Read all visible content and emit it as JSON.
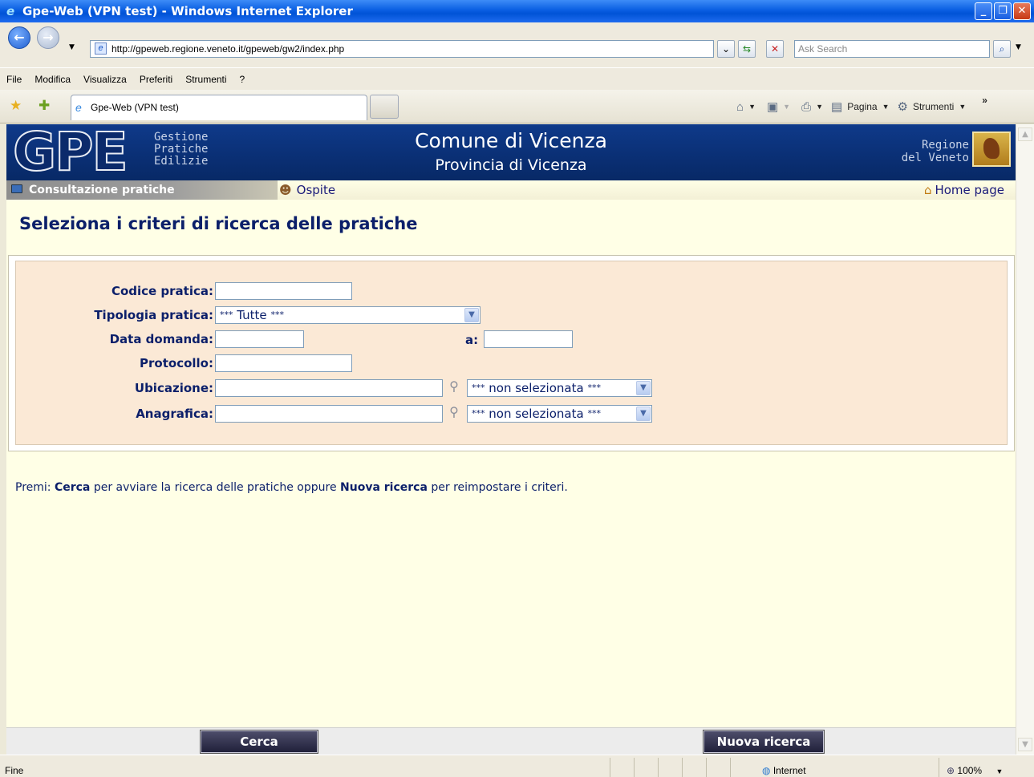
{
  "window": {
    "title": "Gpe-Web (VPN test) - Windows Internet Explorer"
  },
  "browser": {
    "url": "http://gpeweb.regione.veneto.it/gpeweb/gw2/index.php",
    "search_placeholder": "Ask Search",
    "menu": [
      "File",
      "Modifica",
      "Visualizza",
      "Preferiti",
      "Strumenti",
      "?"
    ],
    "tab_title": "Gpe-Web (VPN test)",
    "tools": {
      "pagina": "Pagina",
      "strumenti": "Strumenti"
    },
    "status": {
      "left": "Fine",
      "zone": "Internet",
      "zoom": "100%"
    }
  },
  "header": {
    "logo": "GPE",
    "logo_sub": [
      "Gestione",
      "Pratiche",
      "Edilizie"
    ],
    "comune": "Comune di Vicenza",
    "provincia": "Provincia di Vicenza",
    "regione": [
      "Regione",
      "del Veneto"
    ]
  },
  "nav": {
    "section": "Consultazione pratiche",
    "user": "Ospite",
    "home": "Home page"
  },
  "page_title": "Seleziona i criteri di ricerca delle pratiche",
  "form": {
    "codice_label": "Codice pratica:",
    "tipologia_label": "Tipologia pratica:",
    "tipologia_value": "Tutte",
    "data_label": "Data domanda:",
    "data_to_label": "a:",
    "protocollo_label": "Protocollo:",
    "ubicazione_label": "Ubicazione:",
    "ubicazione_select": "non selezionata",
    "anagrafica_label": "Anagrafica:",
    "anagrafica_select": "non selezionata"
  },
  "note": {
    "prefix": "Premi: ",
    "cerca": "Cerca",
    "middle": " per avviare la ricerca delle pratiche oppure ",
    "nuova": "Nuova ricerca",
    "suffix": " per reimpostare i criteri."
  },
  "buttons": {
    "cerca": "Cerca",
    "nuova_ricerca": "Nuova ricerca"
  }
}
